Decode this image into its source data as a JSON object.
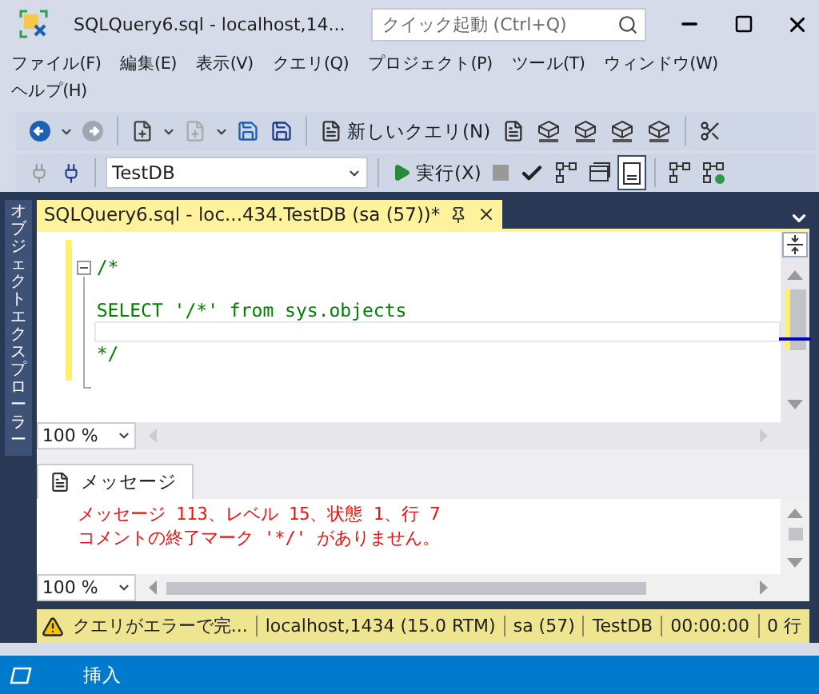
{
  "window": {
    "title": "SQLQuery6.sql - localhost,14...",
    "quick_launch": {
      "placeholder": "クイック起動 (Ctrl+Q)"
    }
  },
  "menu": [
    "ファイル(F)",
    "編集(E)",
    "表示(V)",
    "クエリ(Q)",
    "プロジェクト(P)",
    "ツール(T)",
    "ウィンドウ(W)",
    "ヘルプ(H)"
  ],
  "toolbar": {
    "new_query": "新しいクエリ(N)",
    "database": "TestDB",
    "execute": "実行(X)"
  },
  "side_panel": {
    "title": "オブジェクトエクスプローラー"
  },
  "document_tab": {
    "title": "SQLQuery6.sql - loc...434.TestDB (sa (57))*"
  },
  "editor": {
    "lines": [
      {
        "text": "/*",
        "current": false
      },
      {
        "current": false
      },
      {
        "text": "SELECT '/*' from sys.objects",
        "current": false
      },
      {
        "current": true
      },
      {
        "text": "*/",
        "current": false
      }
    ],
    "zoom": "100 %"
  },
  "results": {
    "tab": "メッセージ",
    "messages": [
      "メッセージ 113、レベル 15、状態 1、行 7",
      "コメントの終了マーク '*/' がありません。"
    ],
    "zoom": "100 %"
  },
  "query_status": {
    "message": "クエリがエラーで完...",
    "server": "localhost,1434 (15.0 RTM)",
    "user": "sa (57)",
    "database": "TestDB",
    "elapsed": "00:00:00",
    "rows": "0 行"
  },
  "status_bar": {
    "mode": "挿入"
  }
}
